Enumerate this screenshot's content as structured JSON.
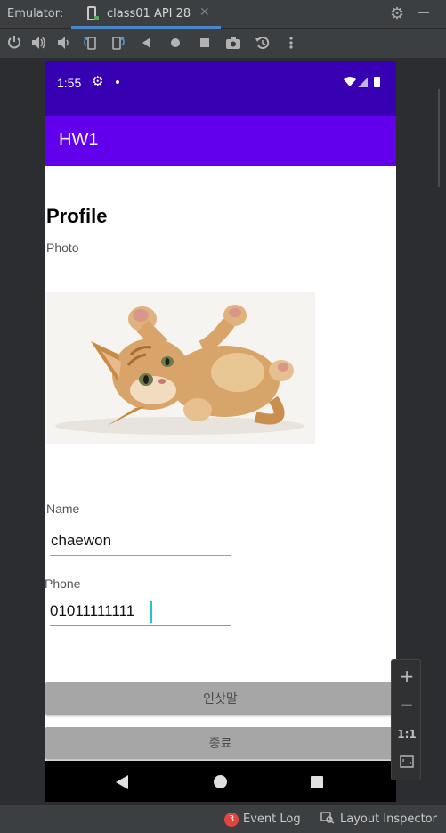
{
  "ide": {
    "emulator_label": "Emulator:",
    "device_tab": "class01 API 28",
    "tab_close": "✕"
  },
  "toolbar": {
    "icons": [
      "power-icon",
      "volume-up-icon",
      "volume-down-icon",
      "rotate-left-icon",
      "rotate-right-icon",
      "back-icon",
      "home-icon",
      "overview-icon",
      "screenshot-icon",
      "snapshot-icon",
      "more-icon"
    ]
  },
  "device": {
    "status": {
      "time": "1:55"
    },
    "app_title": "HW1",
    "profile_heading": "Profile",
    "photo_label": "Photo",
    "name_label": "Name",
    "name_value": "chaewon",
    "phone_label": "Phone",
    "phone_value": "01011111111",
    "greeting_button": "인삿말",
    "exit_button": "종료"
  },
  "zoom": {
    "zoom_in": "+",
    "zoom_out": "−",
    "actual_size": "1:1"
  },
  "statusbar": {
    "event_count": "3",
    "event_log": "Event Log",
    "layout_inspector": "Layout Inspector"
  },
  "colors": {
    "status_bar": "#3700b3",
    "app_bar": "#6200ee",
    "accent": "#1fc7c7",
    "button": "#a6a6a6"
  }
}
